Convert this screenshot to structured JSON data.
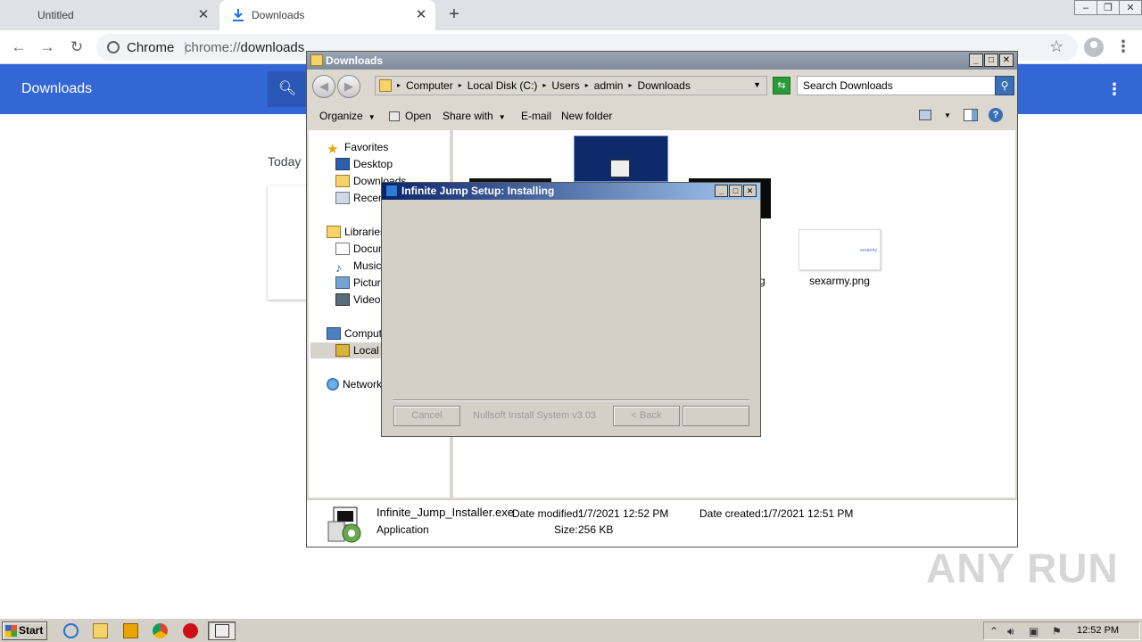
{
  "browser": {
    "tabs": [
      {
        "label": "Untitled"
      },
      {
        "label": "Downloads"
      }
    ],
    "omnibox": {
      "site": "Chrome",
      "url_scheme": "chrome://",
      "url_path": "downloads"
    },
    "page": {
      "title": "Downloads",
      "section": "Today"
    }
  },
  "explorer": {
    "title": "Downloads",
    "breadcrumbs": [
      "Computer",
      "Local Disk (C:)",
      "Users",
      "admin",
      "Downloads"
    ],
    "search_placeholder": "Search Downloads",
    "commands": {
      "organize": "Organize",
      "open": "Open",
      "share": "Share with",
      "email": "E-mail",
      "new_folder": "New folder"
    },
    "nav": {
      "favorites": "Favorites",
      "desktop": "Desktop",
      "downloads": "Downloads",
      "recent": "Recent Places",
      "libraries": "Libraries",
      "documents": "Documents",
      "music": "Music",
      "pictures": "Pictures",
      "videos": "Videos",
      "computer": "Computer",
      "local_disk": "Local Disk (C:)",
      "network": "Network"
    },
    "files": [
      {
        "label": "sexarmy.png",
        "thumb_text": "sexarmy"
      }
    ],
    "partial_label": "g",
    "details": {
      "name": "Infinite_Jump_Installer.exe",
      "type": "Application",
      "modified_label": "Date modified:",
      "modified": "1/7/2021 12:52 PM",
      "created_label": "Date created:",
      "created": "1/7/2021 12:51 PM",
      "size_label": "Size:",
      "size": "256 KB"
    }
  },
  "installer": {
    "title": "Infinite Jump Setup: Installing",
    "cancel": "Cancel",
    "brand": "Nullsoft Install System v3.03",
    "back": "< Back",
    "next": ""
  },
  "taskbar": {
    "start": "Start",
    "clock": "12:52 PM"
  },
  "watermark": "ANY RUN"
}
